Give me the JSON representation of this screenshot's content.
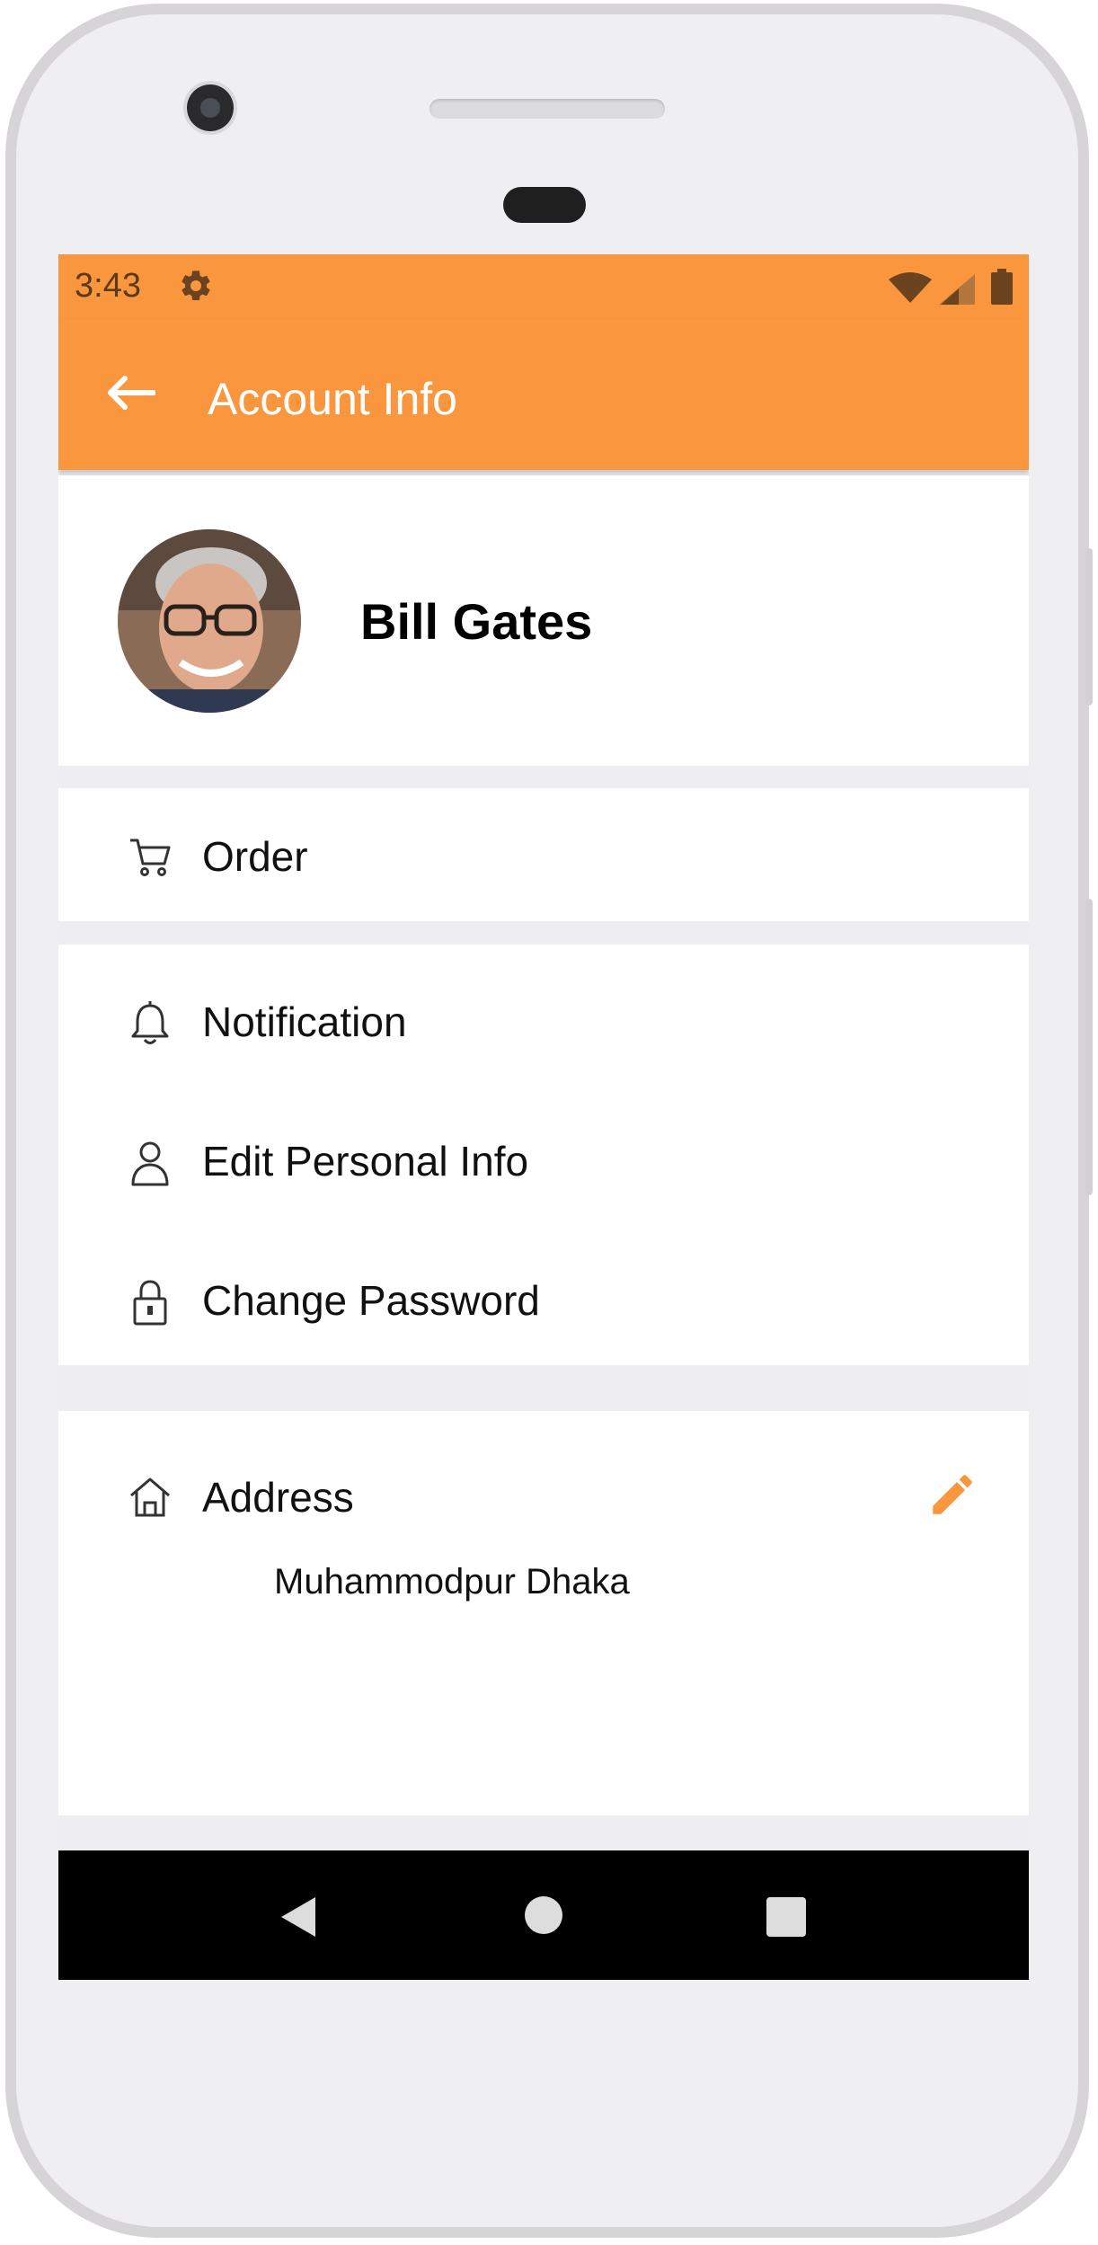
{
  "status_bar": {
    "time": "3:43",
    "icons": [
      "gear-icon",
      "wifi-icon",
      "signal-icon",
      "battery-icon"
    ]
  },
  "app_bar": {
    "title": "Account Info",
    "back_icon": "arrow-left-icon"
  },
  "profile": {
    "name": "Bill Gates",
    "avatar": "profile-photo"
  },
  "menu": {
    "order": {
      "label": "Order",
      "icon": "cart-icon"
    },
    "notification": {
      "label": "Notification",
      "icon": "bell-icon"
    },
    "edit_personal_info": {
      "label": "Edit Personal Info",
      "icon": "user-icon"
    },
    "change_password": {
      "label": "Change Password",
      "icon": "lock-icon"
    }
  },
  "address": {
    "label": "Address",
    "value": "Muhammodpur Dhaka",
    "icon": "home-icon",
    "edit_icon": "pencil-icon"
  },
  "nav_bar": {
    "icons": [
      "back-triangle-icon",
      "home-circle-icon",
      "recents-square-icon"
    ]
  },
  "colors": {
    "accent": "#fa973e",
    "background": "#eeeef2",
    "card": "#ffffff",
    "nav": "#000000"
  }
}
